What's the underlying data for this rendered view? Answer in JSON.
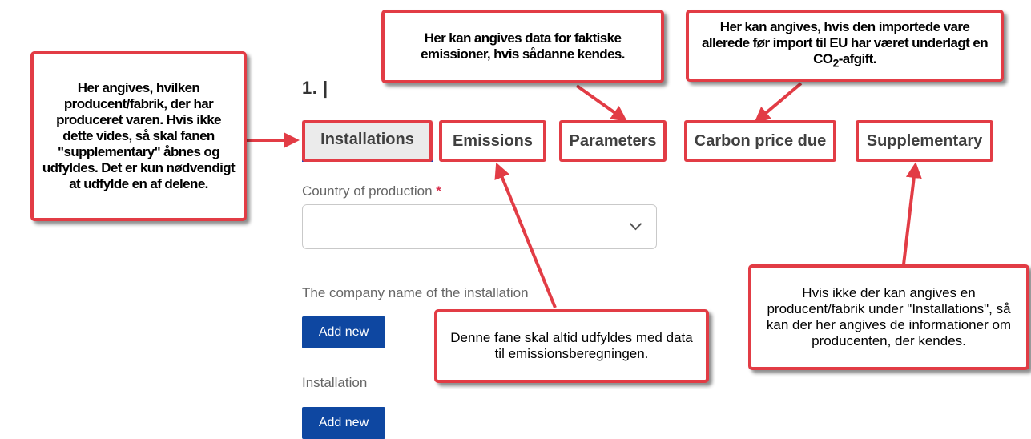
{
  "step": {
    "title": "1. |"
  },
  "tabs": [
    {
      "label": "Installations",
      "active": true
    },
    {
      "label": "Emissions",
      "active": false
    },
    {
      "label": "Parameters",
      "active": false
    },
    {
      "label": "Carbon price due",
      "active": false
    },
    {
      "label": "Supplementary",
      "active": false
    }
  ],
  "form": {
    "country_label": "Country of production",
    "required_mark": "*",
    "country_value": "",
    "company_label": "The company name of the installation",
    "add_new_1": "Add new",
    "installation_label": "Installation",
    "add_new_2": "Add new"
  },
  "annotations": {
    "installations_note": "Her angives, hvilken producent/fabrik, der har produceret varen. Hvis ikke dette vides, så skal fanen \"supplementary\" åbnes og udfyldes. Det er kun nødvendigt at udfylde en af delene.",
    "parameters_note": "Her kan angives data for faktiske emissioner, hvis sådanne kendes.",
    "carbon_note_1": "Her kan angives, hvis den importede vare allerede før import til EU har været underlagt en CO",
    "carbon_note_sub": "2",
    "carbon_note_2": "-afgift.",
    "emissions_note": "Denne fane skal altid udfyldes med data til emissionsberegningen.",
    "supplementary_note": "Hvis ikke der kan angives en producent/fabrik under \"Installations\", så kan der her angives de informationer om producenten, der kendes."
  },
  "colors": {
    "annotation_red": "#e23c45",
    "tab_underline": "#0e47cb",
    "button_blue": "#0e47a1"
  }
}
